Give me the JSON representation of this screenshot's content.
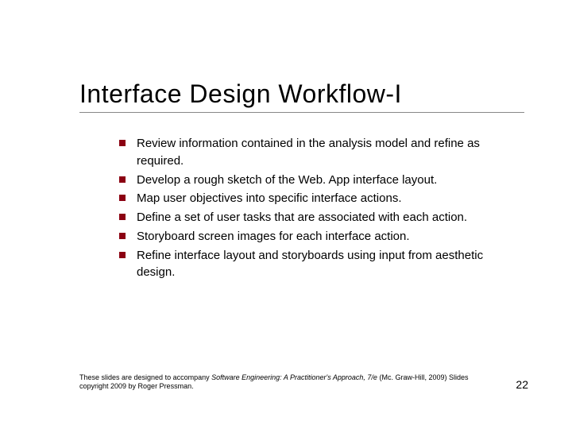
{
  "title": "Interface Design Workflow-I",
  "bullets": [
    "Review information contained in the analysis model and refine as required.",
    "Develop a rough sketch of the Web. App interface layout.",
    "Map user objectives into specific interface actions.",
    "Define a set of user tasks that are associated with each action.",
    "Storyboard screen images for each interface action.",
    "Refine interface layout and storyboards using input from aesthetic design."
  ],
  "footer": {
    "prefix": "These slides are designed to accompany ",
    "italic": "Software Engineering: A Practitioner's Approach, 7/e",
    "suffix": " (Mc. Graw-Hill, 2009) Slides copyright 2009 by Roger Pressman."
  },
  "page_number": "22"
}
